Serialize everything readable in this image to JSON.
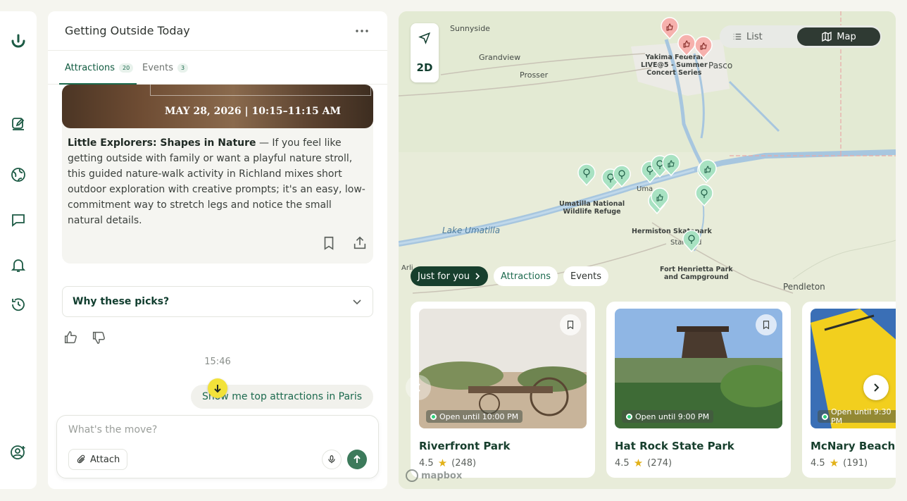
{
  "chat": {
    "title": "Getting Outside Today",
    "tabs": [
      {
        "label": "Attractions",
        "count": "20"
      },
      {
        "label": "Events",
        "count": "3"
      }
    ],
    "event_card": {
      "date_text": "MAY 28, 2026 | 10:15–11:15 AM",
      "title": "Little Explorers: Shapes in Nature",
      "body": " — If you feel like getting outside with family or want a playful nature stroll, this guided nature-walk activity in Richland mixes short outdoor exploration with creative prompts; it's an easy, low-commitment way to stretch legs and notice the small natural details."
    },
    "why_label": "Why these picks?",
    "time": "15:46",
    "user_message": "Show me top attractions in Paris",
    "composer": {
      "placeholder": "What's the move?",
      "attach_label": "Attach"
    }
  },
  "map": {
    "ctrl_2d": "2D",
    "toggle": {
      "list": "List",
      "map": "Map"
    },
    "labels": {
      "sunnyside": "Sunnyside",
      "grandview": "Grandview",
      "prosser": "Prosser",
      "pasco": "Pasco",
      "yakima": "Yakima Federal\nLIVE@5 - Summer\nConcert Series",
      "umatilla_refuge": "Umatilla National\nWildlife Refuge",
      "lake": "Lake Umatilla",
      "hermiston": "Hermiston Skatepark",
      "stanfield": "Stanfield",
      "fort": "Fort Henrietta Park\nand Campground",
      "pendleton": "Pendleton",
      "umatilla": "Uma",
      "arlington": "Arli"
    },
    "chips": [
      "Just for you",
      "Attractions",
      "Events"
    ],
    "places": [
      {
        "name": "Riverfront Park",
        "rating": "4.5",
        "reviews": "(248)",
        "open": "Open until 10:00 PM"
      },
      {
        "name": "Hat Rock State Park",
        "rating": "4.5",
        "reviews": "(274)",
        "open": "Open until 9:00 PM"
      },
      {
        "name": "McNary Beach Park",
        "rating": "4.5",
        "reviews": "(191)",
        "open": "Open until 9:30 PM"
      }
    ],
    "attribution": "mapbox"
  },
  "colors": {
    "accent": "#1c6a4e",
    "dark": "#173f2d",
    "highlight": "#f2e23a",
    "pin_green": "#7fd0a6",
    "pin_red": "#f29a96"
  }
}
